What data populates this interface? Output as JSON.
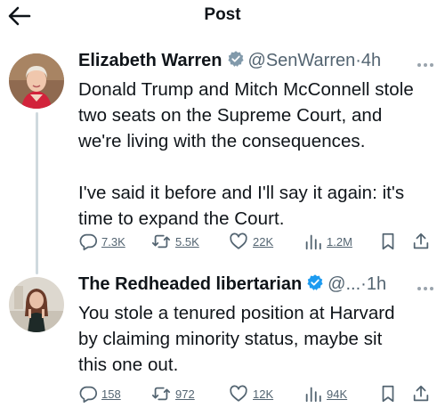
{
  "header": {
    "title": "Post"
  },
  "tweets": [
    {
      "name": "Elizabeth Warren",
      "handle": "@SenWarren",
      "separator": "·",
      "time": "4h",
      "verified_color": "#829aab",
      "text": "Donald Trump and Mitch McConnell stole\ntwo seats on the Supreme Court, and\nwe're living with the consequences.\n\nI've said it before and I'll say it again: it's\ntime to expand the Court.",
      "replies": "7.3K",
      "reposts": "5.5K",
      "likes": "22K",
      "views": "1.2M"
    },
    {
      "name": "The Redheaded libertarian",
      "handle": "@...",
      "separator": "·",
      "time": "1h",
      "verified_color": "#1d9bf0",
      "text": "You stole a tenured position at Harvard\nby claiming minority status, maybe sit\nthis one out.",
      "replies": "158",
      "reposts": "972",
      "likes": "12K",
      "views": "94K"
    }
  ],
  "colors": {
    "text": "#0f1419",
    "secondary": "#536471",
    "thread_line": "#cfd9de"
  },
  "icons": [
    "back-arrow-icon",
    "verified-badge-icon",
    "more-icon",
    "reply-icon",
    "repost-icon",
    "like-icon",
    "views-icon",
    "bookmark-icon",
    "share-icon"
  ]
}
